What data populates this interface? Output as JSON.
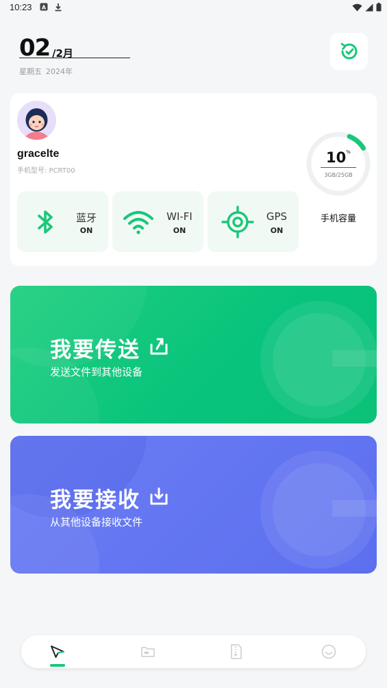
{
  "status_bar": {
    "time": "10:23"
  },
  "header": {
    "day": "02",
    "month": "/2月",
    "weekday": "星期五",
    "year": "2024年"
  },
  "profile": {
    "username": "gracelte",
    "model": "手机型号: PCRT00"
  },
  "toggles": [
    {
      "label": "蓝牙",
      "state": "ON",
      "icon": "bluetooth-icon"
    },
    {
      "label": "WI-FI",
      "state": "ON",
      "icon": "wifi-icon"
    },
    {
      "label": "GPS",
      "state": "ON",
      "icon": "gps-icon"
    }
  ],
  "storage": {
    "percent": "10",
    "percent_unit": "%",
    "usage": "3GB/25GB",
    "label": "手机容量",
    "fraction": 0.1
  },
  "send_card": {
    "title": "我要传送",
    "subtitle": "发送文件到其他设备"
  },
  "receive_card": {
    "title": "我要接收",
    "subtitle": "从其他设备接收文件"
  },
  "nav": {
    "items": [
      {
        "icon": "send-icon",
        "active": true
      },
      {
        "icon": "folder-icon",
        "active": false
      },
      {
        "icon": "zip-file-icon",
        "active": false
      },
      {
        "icon": "profile-icon",
        "active": false
      }
    ]
  },
  "colors": {
    "accent_green": "#19c77a",
    "send_card": "#0cc67c",
    "receive_card": "#6376f2",
    "background": "#f5f6f7"
  }
}
